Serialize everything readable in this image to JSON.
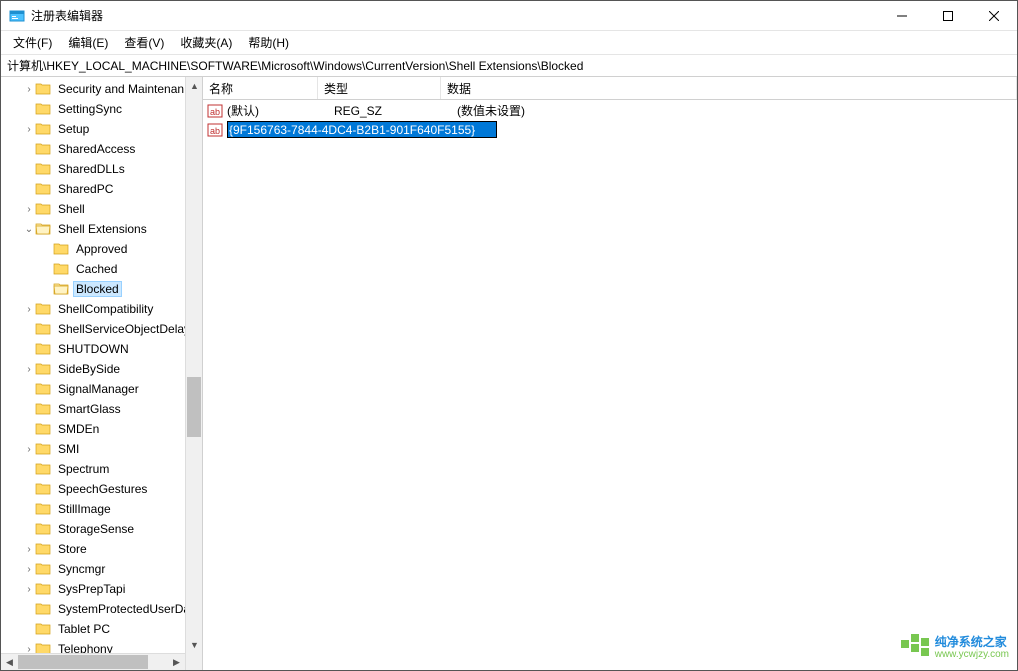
{
  "window": {
    "title": "注册表编辑器"
  },
  "menubar": [
    "文件(F)",
    "编辑(E)",
    "查看(V)",
    "收藏夹(A)",
    "帮助(H)"
  ],
  "address": "计算机\\HKEY_LOCAL_MACHINE\\SOFTWARE\\Microsoft\\Windows\\CurrentVersion\\Shell Extensions\\Blocked",
  "tree_items": [
    {
      "indent": 1,
      "exp": ">",
      "label": "Security and Maintenan",
      "sel": false
    },
    {
      "indent": 1,
      "exp": "",
      "label": "SettingSync",
      "sel": false
    },
    {
      "indent": 1,
      "exp": ">",
      "label": "Setup",
      "sel": false
    },
    {
      "indent": 1,
      "exp": "",
      "label": "SharedAccess",
      "sel": false
    },
    {
      "indent": 1,
      "exp": "",
      "label": "SharedDLLs",
      "sel": false
    },
    {
      "indent": 1,
      "exp": "",
      "label": "SharedPC",
      "sel": false
    },
    {
      "indent": 1,
      "exp": ">",
      "label": "Shell",
      "sel": false
    },
    {
      "indent": 1,
      "exp": "v",
      "label": "Shell Extensions",
      "sel": false
    },
    {
      "indent": 2,
      "exp": "",
      "label": "Approved",
      "sel": false
    },
    {
      "indent": 2,
      "exp": "",
      "label": "Cached",
      "sel": false
    },
    {
      "indent": 2,
      "exp": "",
      "label": "Blocked",
      "sel": true
    },
    {
      "indent": 1,
      "exp": ">",
      "label": "ShellCompatibility",
      "sel": false
    },
    {
      "indent": 1,
      "exp": "",
      "label": "ShellServiceObjectDelay",
      "sel": false
    },
    {
      "indent": 1,
      "exp": "",
      "label": "SHUTDOWN",
      "sel": false
    },
    {
      "indent": 1,
      "exp": ">",
      "label": "SideBySide",
      "sel": false
    },
    {
      "indent": 1,
      "exp": "",
      "label": "SignalManager",
      "sel": false
    },
    {
      "indent": 1,
      "exp": "",
      "label": "SmartGlass",
      "sel": false
    },
    {
      "indent": 1,
      "exp": "",
      "label": "SMDEn",
      "sel": false
    },
    {
      "indent": 1,
      "exp": ">",
      "label": "SMI",
      "sel": false
    },
    {
      "indent": 1,
      "exp": "",
      "label": "Spectrum",
      "sel": false
    },
    {
      "indent": 1,
      "exp": "",
      "label": "SpeechGestures",
      "sel": false
    },
    {
      "indent": 1,
      "exp": "",
      "label": "StillImage",
      "sel": false
    },
    {
      "indent": 1,
      "exp": "",
      "label": "StorageSense",
      "sel": false
    },
    {
      "indent": 1,
      "exp": ">",
      "label": "Store",
      "sel": false
    },
    {
      "indent": 1,
      "exp": ">",
      "label": "Syncmgr",
      "sel": false
    },
    {
      "indent": 1,
      "exp": ">",
      "label": "SysPrepTapi",
      "sel": false
    },
    {
      "indent": 1,
      "exp": "",
      "label": "SystemProtectedUserDa",
      "sel": false
    },
    {
      "indent": 1,
      "exp": "",
      "label": "Tablet PC",
      "sel": false
    },
    {
      "indent": 1,
      "exp": ">",
      "label": "Telephony",
      "sel": false
    }
  ],
  "columns": {
    "name": "名称",
    "type": "类型",
    "data": "数据"
  },
  "list": [
    {
      "icon": "str",
      "name": "(默认)",
      "type": "REG_SZ",
      "data": "(数值未设置)",
      "editing": false
    },
    {
      "icon": "str",
      "name": "{9F156763-7844-4DC4-B2B1-901F640F5155}",
      "type": "",
      "data": "",
      "editing": true
    }
  ],
  "watermark": {
    "line1": "纯净系统之家",
    "line2": "www.ycwjzy.com"
  }
}
